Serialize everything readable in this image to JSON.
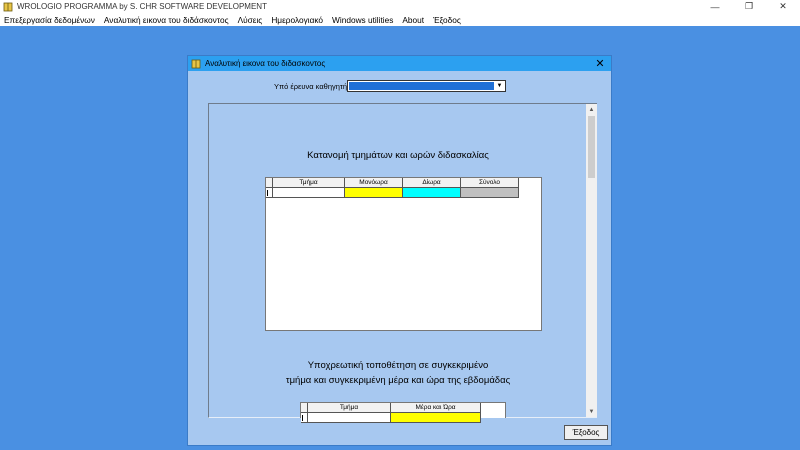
{
  "app": {
    "title": "WROLOGIO PROGRAMMA by S. CHR SOFTWARE DEVELOPMENT",
    "controls": {
      "minimize": "—",
      "restore": "❐",
      "close": "✕"
    }
  },
  "menu": {
    "items": [
      "Επεξεργασία δεδομένων",
      "Αναλυτική εικονα του διδάσκοντος",
      "Λύσεις",
      "Ημερολογιακό",
      "Windows utilities",
      "About",
      "Έξοδος"
    ]
  },
  "dialog": {
    "title": "Αναλυτική εικονα του διδασκοντος",
    "close_glyph": "✕",
    "professor_label": "Υπό έρευνα καθηγητής:",
    "professor_value": "",
    "exit_button": "Έξοδος",
    "section1": {
      "title": "Κατανομή τμημάτων και ωρών διδασκαλίας",
      "columns": [
        "Τμήμα",
        "Μονόωρα",
        "Δίωρα",
        "Σύνολο"
      ],
      "column_colors": [
        "#ffffff",
        "#ffff00",
        "#00ffff",
        "#c0c0c0"
      ]
    },
    "section2": {
      "title_line1": "Υποχρεωτική τοποθέτηση σε συγκεκριμένο",
      "title_line2": "τμήμα και συγκεκριμένη μέρα και ώρα της εβδομάδας",
      "columns": [
        "Τμήμα",
        "Μέρα και Ώρα"
      ],
      "column_colors": [
        "#ffffff",
        "#ffff00"
      ]
    }
  },
  "colors": {
    "desktop": "#4a90e2",
    "dialog_bg": "#a7c8f0",
    "dialog_titlebar": "#2ca0f0",
    "select_highlight": "#1f6fd6"
  },
  "icons": {
    "app": "book-icon",
    "dialog": "book-icon",
    "scroll_up": "chevron-up-icon",
    "scroll_down": "chevron-down-icon",
    "dropdown": "triangle-down-icon"
  }
}
